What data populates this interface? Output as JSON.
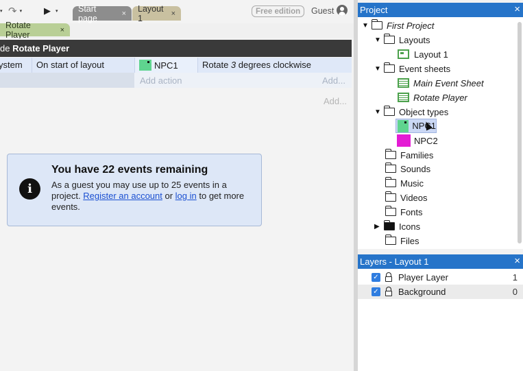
{
  "toolbar": {
    "tabs": [
      {
        "label": "Start page"
      },
      {
        "label": "Layout 1"
      }
    ],
    "free_badge": "Free edition",
    "guest_label": "Guest",
    "sub_tab": "Rotate Player",
    "close_glyph": "×"
  },
  "event_sheet": {
    "group_prefix": "de ",
    "group_name": "Rotate Player",
    "event": {
      "system_text": "ystem",
      "condition": "On start of layout",
      "object": "NPC1",
      "action_prefix": "Rotate ",
      "action_amount": "3",
      "action_suffix": " degrees clockwise"
    },
    "add_action": "Add action",
    "add_small_1": "Add...",
    "add_small_2": "Add..."
  },
  "notice": {
    "title": "You have 22 events remaining",
    "text_1": "As a guest you may use up to 25 events in a project. ",
    "link_register": "Register an account",
    "text_2": " or ",
    "link_login": "log in",
    "text_3": " to get more events."
  },
  "project_panel": {
    "title": "Project",
    "tree": [
      {
        "label": "First Project"
      },
      {
        "label": "Layouts"
      },
      {
        "label": "Layout 1"
      },
      {
        "label": "Event sheets"
      },
      {
        "label": "Main Event Sheet"
      },
      {
        "label": "Rotate Player"
      },
      {
        "label": "Object types"
      },
      {
        "label": "NPC1"
      },
      {
        "label": "NPC2"
      },
      {
        "label": "Families"
      },
      {
        "label": "Sounds"
      },
      {
        "label": "Music"
      },
      {
        "label": "Videos"
      },
      {
        "label": "Fonts"
      },
      {
        "label": "Icons"
      },
      {
        "label": "Files"
      }
    ]
  },
  "layers_panel": {
    "title": "Layers - Layout 1",
    "layers": [
      {
        "name": "Player Layer",
        "index": "1",
        "visible": true
      },
      {
        "name": "Background",
        "index": "0",
        "visible": true
      }
    ]
  },
  "colors": {
    "accent": "#2674c9",
    "npc1": "#5fd48f",
    "npc2": "#e41bd4",
    "group_header": "#3a3a3a",
    "notice_bg": "#dde7f7"
  }
}
